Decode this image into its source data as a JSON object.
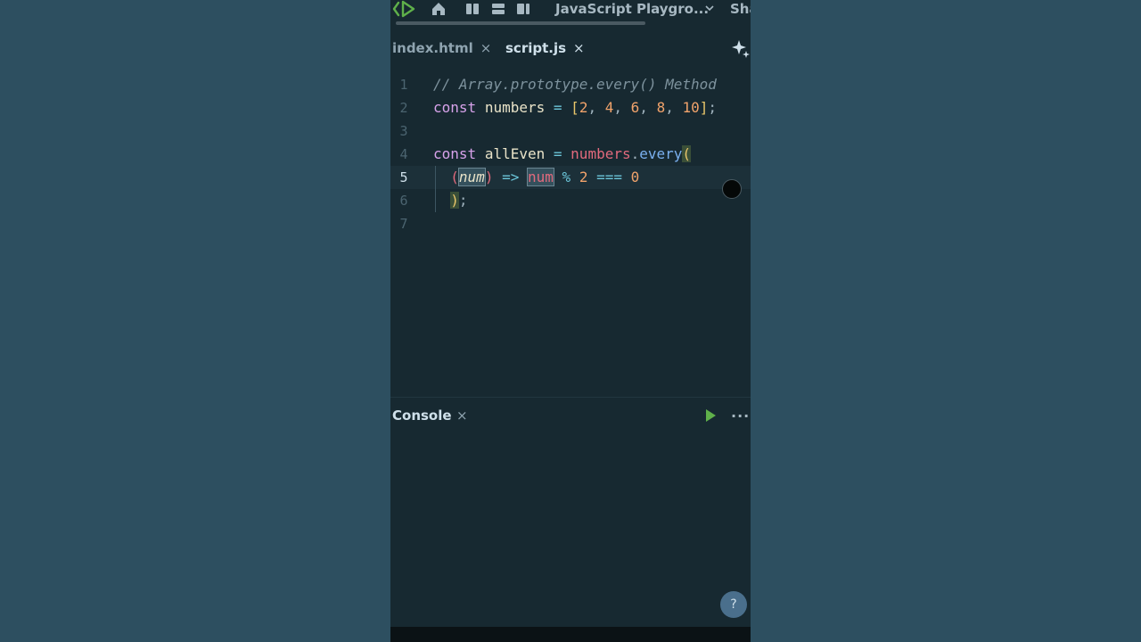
{
  "topbar": {
    "project_title": "JavaScript Playgro...",
    "share_label": "Sha"
  },
  "tabs": [
    {
      "label": "index.html",
      "close": "×"
    },
    {
      "label": "script.js",
      "close": "×",
      "active": true
    }
  ],
  "editor": {
    "line_numbers": [
      "1",
      "2",
      "3",
      "4",
      "5",
      "6",
      "7"
    ],
    "active_line": 5,
    "tokens": {
      "l1_comment": "// Array.prototype.every() Method",
      "l2_const": "const",
      "l2_name": "numbers",
      "l2_eq": "=",
      "l2_open": "[",
      "l2_n1": "2",
      "l2_n2": "4",
      "l2_n3": "6",
      "l2_n4": "8",
      "l2_n5": "10",
      "l2_comma": ",",
      "l2_close": "]",
      "l2_semi": ";",
      "l4_const": "const",
      "l4_name": "allEven",
      "l4_eq": "=",
      "l4_obj": "numbers",
      "l4_dot": ".",
      "l4_method": "every",
      "l4_paren": "(",
      "l5_open": "(",
      "l5_param": "num",
      "l5_close": ")",
      "l5_arrow": "=>",
      "l5_var": "num",
      "l5_mod": "%",
      "l5_two": "2",
      "l5_eqeq": "===",
      "l5_zero": "0",
      "l6_paren": ")",
      "l6_semi": ";"
    }
  },
  "console": {
    "title": "Console",
    "close": "×",
    "more": "···"
  },
  "help_label": "?",
  "colors": {
    "background": "#2d4f60",
    "editor_bg": "#172931",
    "keyword": "#d7a2ea",
    "number": "#f1a36b",
    "function": "#7ab0ef",
    "property": "#e26a7d",
    "run_button": "#5fb04a"
  },
  "icons": [
    "codepen-logo-icon",
    "home-icon",
    "panel-layout-icon",
    "chevron-down-icon",
    "sparkle-icon",
    "play-icon",
    "more-icon",
    "help-icon"
  ]
}
